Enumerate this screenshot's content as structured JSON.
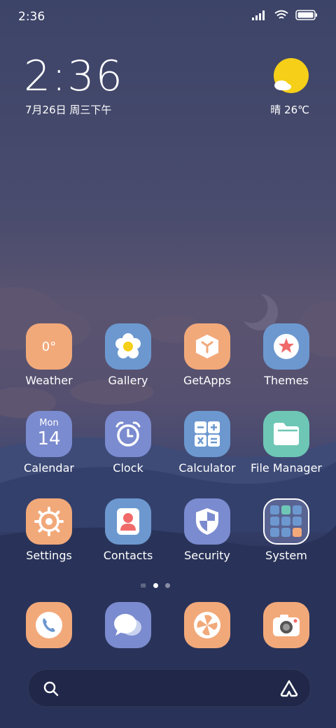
{
  "status_bar": {
    "time": "2:36"
  },
  "widget": {
    "time": "2:36",
    "date": "7月26日 周三下午",
    "weather": "晴 26℃"
  },
  "apps": [
    {
      "label": "Weather"
    },
    {
      "label": "Gallery"
    },
    {
      "label": "GetApps"
    },
    {
      "label": "Themes"
    },
    {
      "label": "Calendar"
    },
    {
      "label": "Clock"
    },
    {
      "label": "Calculator"
    },
    {
      "label": "File Manager"
    },
    {
      "label": "Settings"
    },
    {
      "label": "Contacts"
    },
    {
      "label": "Security"
    },
    {
      "label": "System"
    }
  ],
  "weather_icon_text": "0°",
  "calendar_icon": {
    "day": "Mon",
    "date": "14"
  },
  "dock": [
    "phone-icon",
    "messages-icon",
    "browser-icon",
    "camera-icon"
  ],
  "colors": {
    "peach": "#f2a97a",
    "blue": "#6c98cf",
    "purple": "#7b8bcf",
    "teal": "#6ec7b5"
  }
}
